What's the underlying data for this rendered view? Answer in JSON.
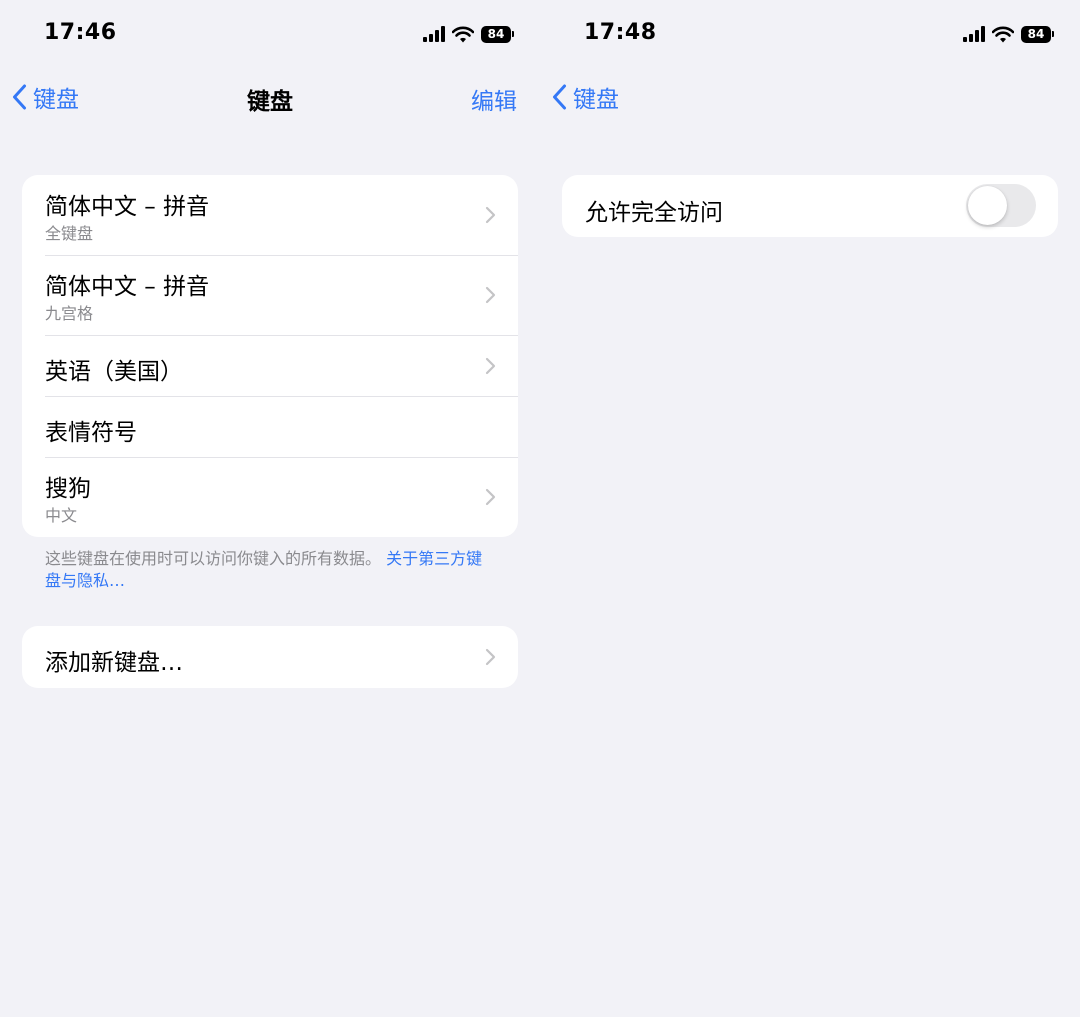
{
  "left": {
    "status": {
      "time": "17:46",
      "battery": "84"
    },
    "nav": {
      "back_label": "键盘",
      "title": "键盘",
      "action_label": "编辑"
    },
    "keyboards": [
      {
        "title": "简体中文 – 拼音",
        "subtitle": "全键盘"
      },
      {
        "title": "简体中文 – 拼音",
        "subtitle": "九宫格"
      },
      {
        "title": "英语（美国）"
      },
      {
        "title": "表情符号"
      },
      {
        "title": "搜狗",
        "subtitle": "中文"
      }
    ],
    "footnote": {
      "text": "这些键盘在使用时可以访问你键入的所有数据。",
      "link": "关于第三方键盘与隐私…"
    },
    "add_keyboard_label": "添加新键盘…"
  },
  "right": {
    "status": {
      "time": "17:48",
      "battery": "84"
    },
    "nav": {
      "back_label": "键盘"
    },
    "full_access": {
      "label": "允许完全访问",
      "enabled": false
    }
  },
  "colors": {
    "accent": "#3478f6",
    "background": "#f2f2f7",
    "secondary_text": "#8a8a8e",
    "toggle_off": "#e9e9eb"
  },
  "icons": {
    "back": "chevron-left-icon",
    "disclosure": "chevron-right-icon",
    "signal": "cellular-signal-icon",
    "wifi": "wifi-icon",
    "battery": "battery-icon"
  }
}
